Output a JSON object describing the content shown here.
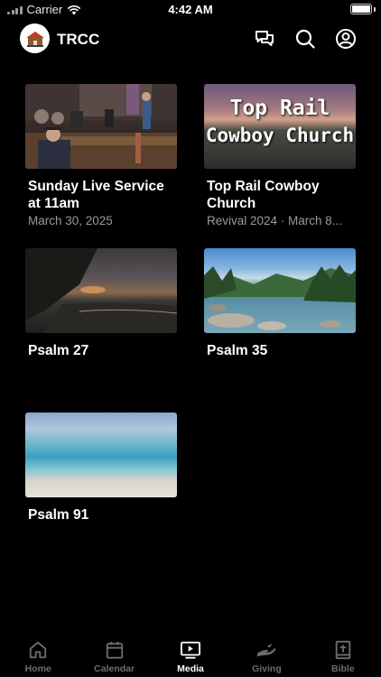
{
  "status_bar": {
    "carrier": "Carrier",
    "time": "4:42 AM"
  },
  "header": {
    "title": "TRCC"
  },
  "media": [
    {
      "title": "Sunday Live Service\nat 11am",
      "subtitle": "March 30, 2025"
    },
    {
      "title": "Top Rail Cowboy\nChurch",
      "subtitle": "Revival 2024 · March 8...",
      "thumb_text_1": "Top Rail",
      "thumb_text_2": "Cowboy Church"
    },
    {
      "title": "Psalm 27",
      "subtitle": ""
    },
    {
      "title": "Psalm 35",
      "subtitle": ""
    },
    {
      "title": "Psalm 91",
      "subtitle": ""
    }
  ],
  "tabs": [
    {
      "label": "Home",
      "icon": "home-icon"
    },
    {
      "label": "Calendar",
      "icon": "calendar-icon"
    },
    {
      "label": "Media",
      "icon": "media-icon",
      "active": true
    },
    {
      "label": "Giving",
      "icon": "giving-icon"
    },
    {
      "label": "Bible",
      "icon": "bible-icon"
    }
  ],
  "colors": {
    "background": "#000000",
    "text": "#ffffff",
    "muted": "#9a9a9a",
    "inactive_tab": "#6d6d6d"
  }
}
